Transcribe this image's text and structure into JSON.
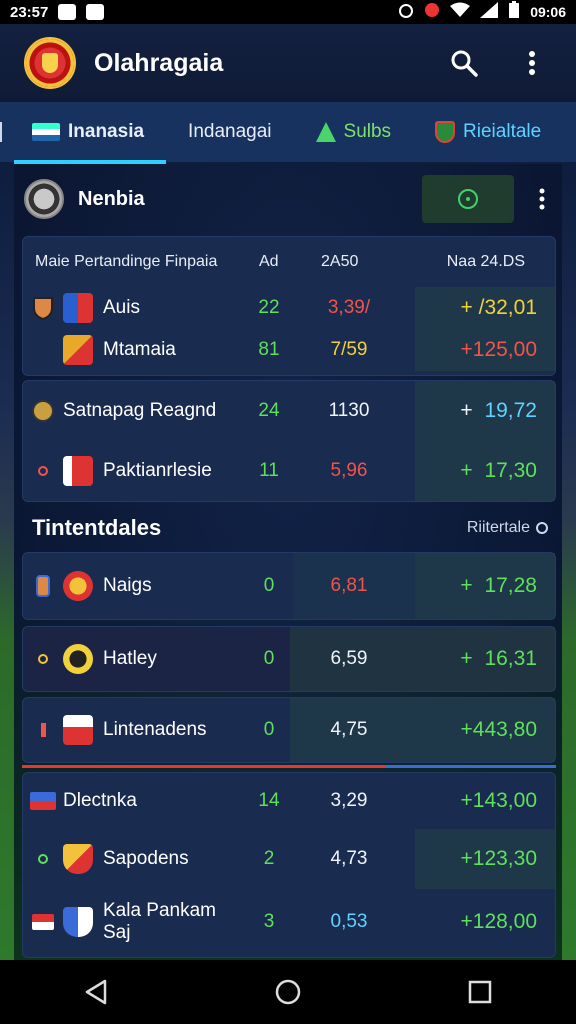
{
  "status_bar": {
    "left_time": "23:57",
    "right_time": "09:06"
  },
  "app": {
    "title": "Olahragaia"
  },
  "tabs": [
    {
      "label": "Inanasia",
      "active": true
    },
    {
      "label": "Indanagai",
      "active": false
    },
    {
      "label": "Sulbs",
      "active": false
    },
    {
      "label": "Rieialtale",
      "active": false
    }
  ],
  "league": {
    "name": "Nenbia"
  },
  "table1": {
    "headers": {
      "name": "Maie Pertandinge Finpaia",
      "c1": "Ad",
      "c2": "2A50",
      "c3": "Naa 24.DS"
    },
    "rows": [
      {
        "name": "Auis",
        "c1": "22",
        "c2": "3,39/",
        "c3": "+ /32,01"
      },
      {
        "name": "Mtamaia",
        "c1": "81",
        "c2": "7/59",
        "c3": "+125,00"
      }
    ]
  },
  "table2": {
    "rows": [
      {
        "name": "Satnapag Reagnd",
        "c1": "24",
        "c2": "1130",
        "c3_sign": "+",
        "c3": "19,72"
      },
      {
        "name": "Paktianrlesie",
        "c1": "11",
        "c2": "5,96",
        "c3_sign": "+",
        "c3": "17,30"
      }
    ]
  },
  "section": {
    "title": "Tintentdales",
    "link": "Riitertale"
  },
  "table3": {
    "rows": [
      {
        "name": "Naigs",
        "c1": "0",
        "c2": "6,81",
        "c3_sign": "+",
        "c3": "17,28"
      },
      {
        "name": "Hatley",
        "c1": "0",
        "c2": "6,59",
        "c3_sign": "+",
        "c3": "16,31"
      },
      {
        "name": "Lintenadens",
        "c1": "0",
        "c2": "4,75",
        "c3": "+443,80"
      }
    ]
  },
  "table4": {
    "rows": [
      {
        "name": "Dlectnka",
        "c1": "14",
        "c2": "3,29",
        "c3": "+143,00"
      },
      {
        "name": "Sapodens",
        "c1": "2",
        "c2": "4,73",
        "c3": "+123,30"
      },
      {
        "name": "Kala Pankam Saj",
        "c1": "3",
        "c2": "0,53",
        "c3": "+128,00"
      }
    ]
  },
  "colors": {
    "accent": "#2ed0ff",
    "positive": "#5ee05a",
    "negative": "#f0544a",
    "highlight": "#f2d23a"
  }
}
